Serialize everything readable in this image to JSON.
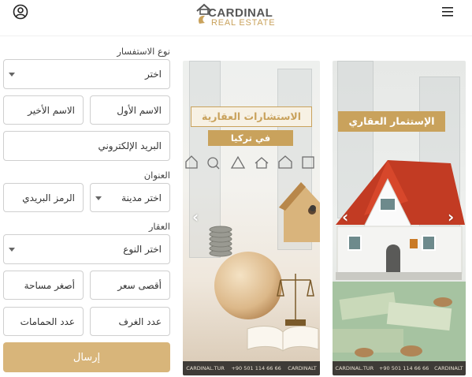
{
  "header": {
    "logo_line1": "CARDINAL",
    "logo_line2": "REAL ESTATE",
    "user_icon": "user-circle-icon",
    "menu_icon": "hamburger-menu-icon"
  },
  "form": {
    "inquiry_type_label": "نوع الاستفسار",
    "inquiry_type_value": "اختر",
    "first_name_placeholder": "الاسم الأول",
    "last_name_placeholder": "الاسم الأخير",
    "email_placeholder": "البريد الإلكتروني",
    "address_label": "العنوان",
    "city_value": "اختر مدينة",
    "postal_placeholder": "الرمز البريدي",
    "property_label": "العقار",
    "property_type_value": "اختر النوع",
    "max_price_placeholder": "أقصى سعر",
    "min_area_placeholder": "أصغر مساحة",
    "rooms_placeholder": "عدد الغرف",
    "bathrooms_placeholder": "عدد الحمامات",
    "submit_label": "إرسال"
  },
  "banners": {
    "left_title": "الاستشارات العقارية",
    "left_subtitle": "في تركيا",
    "left_footer": [
      "CARDINAL.TUR",
      "+90 501 114 66 66",
      "CARDINALT"
    ],
    "right_title": "الإستثمار العقاري",
    "right_footer": [
      "CARDINAL.TUR",
      "+90 501 114 66 66",
      "CARDINALT"
    ]
  },
  "colors": {
    "accent": "#c9a25c",
    "submit_bg": "#d8b57a",
    "border": "#cfcfcf",
    "footer_strip": "#3e3b37"
  }
}
